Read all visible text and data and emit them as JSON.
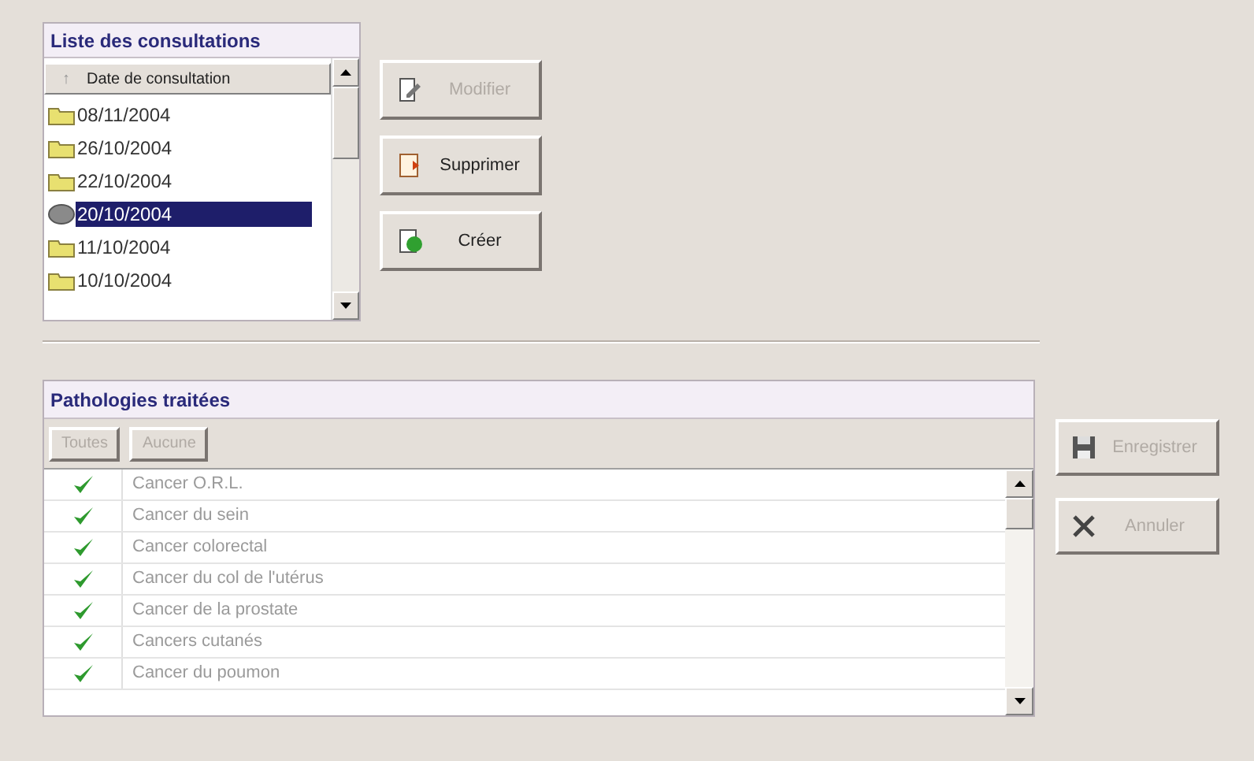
{
  "consultations": {
    "title": "Liste des consultations",
    "column": "Date de consultation",
    "sort_mark": "↑",
    "rows": [
      {
        "date": "08/11/2004",
        "kind": "folder",
        "selected": false
      },
      {
        "date": "26/10/2004",
        "kind": "folder",
        "selected": false
      },
      {
        "date": "22/10/2004",
        "kind": "folder",
        "selected": false
      },
      {
        "date": "20/10/2004",
        "kind": "current",
        "selected": true
      },
      {
        "date": "11/10/2004",
        "kind": "folder",
        "selected": false
      },
      {
        "date": "10/10/2004",
        "kind": "folder",
        "selected": false
      }
    ]
  },
  "actions": [
    {
      "label": "Modifier",
      "kind": "edit",
      "disabled": true
    },
    {
      "label": "Supprimer",
      "kind": "delete",
      "disabled": false
    },
    {
      "label": "Créer",
      "kind": "create",
      "disabled": false
    }
  ],
  "pathologies": {
    "title": "Pathologies traitées",
    "toolbar": [
      {
        "label": "Toutes",
        "disabled": true
      },
      {
        "label": "Aucune",
        "disabled": true
      }
    ],
    "rows": [
      {
        "label": "Cancer O.R.L.",
        "checked": true
      },
      {
        "label": "Cancer du sein",
        "checked": true
      },
      {
        "label": "Cancer colorectal",
        "checked": true
      },
      {
        "label": "Cancer du col de l'utérus",
        "checked": true
      },
      {
        "label": "Cancer de la prostate",
        "checked": true
      },
      {
        "label": "Cancers cutanés",
        "checked": true
      },
      {
        "label": "Cancer du poumon",
        "checked": true
      }
    ]
  },
  "side_buttons": [
    {
      "label": "Enregistrer",
      "kind": "save",
      "disabled": true
    },
    {
      "label": "Annuler",
      "kind": "cancel",
      "disabled": true
    }
  ]
}
